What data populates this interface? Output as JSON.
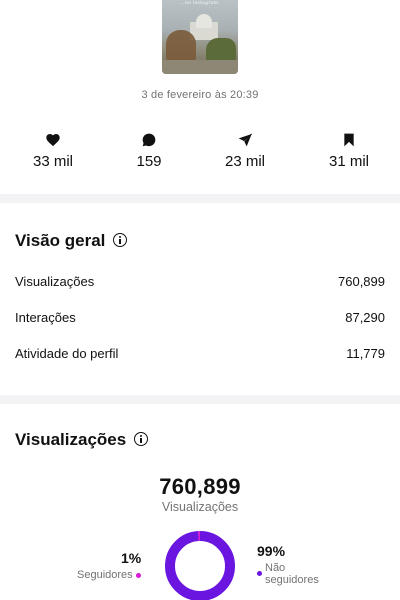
{
  "post": {
    "thumbnail_caption": "...ne instagram.",
    "date": "3 de fevereiro às 20:39"
  },
  "stats": [
    {
      "icon": "heart-icon",
      "value": "33 mil"
    },
    {
      "icon": "comment-icon",
      "value": "159"
    },
    {
      "icon": "send-icon",
      "value": "23 mil"
    },
    {
      "icon": "bookmark-icon",
      "value": "31 mil"
    }
  ],
  "overview": {
    "title": "Visão geral",
    "rows": [
      {
        "label": "Visualizações",
        "value": "760,899"
      },
      {
        "label": "Interações",
        "value": "87,290"
      },
      {
        "label": "Atividade do perfil",
        "value": "11,779"
      }
    ]
  },
  "views": {
    "title": "Visualizações",
    "total": "760,899",
    "total_label": "Visualizações",
    "followers_pct": "1%",
    "followers_label": "Seguidores",
    "non_followers_pct": "99%",
    "non_followers_label": "Não seguidores",
    "followers_fraction": 0.01,
    "non_followers_fraction": 0.99
  },
  "colors": {
    "followers": "#d91bd4",
    "non_followers": "#6a15e0"
  }
}
